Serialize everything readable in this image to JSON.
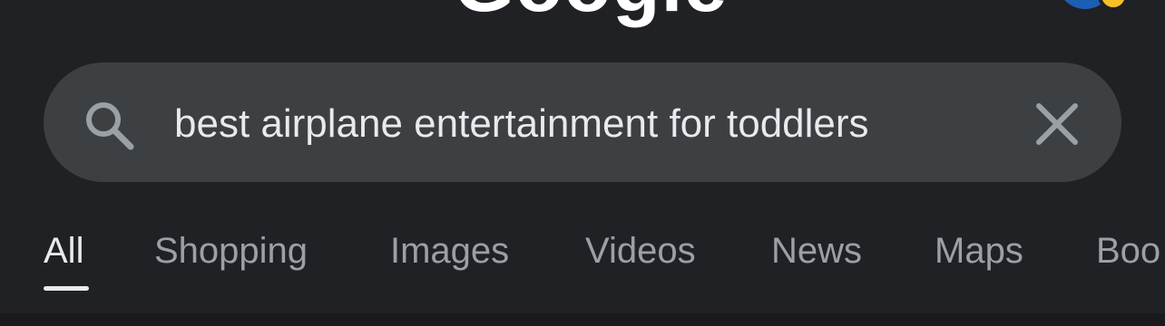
{
  "header": {
    "logo_text": "Google"
  },
  "search": {
    "query": "best airplane entertainment for toddlers"
  },
  "tabs": [
    {
      "label": "All",
      "active": true
    },
    {
      "label": "Shopping",
      "active": false
    },
    {
      "label": "Images",
      "active": false
    },
    {
      "label": "Videos",
      "active": false
    },
    {
      "label": "News",
      "active": false
    },
    {
      "label": "Maps",
      "active": false
    },
    {
      "label": "Boo",
      "active": false
    }
  ],
  "icons": {
    "search": "search-icon",
    "clear": "close-icon",
    "avatar": "avatar"
  },
  "colors": {
    "background": "#202124",
    "search_bar": "#3c4043",
    "text_primary": "#e8eaed",
    "text_secondary": "#9aa0a6",
    "icon": "#9aa0a6"
  }
}
